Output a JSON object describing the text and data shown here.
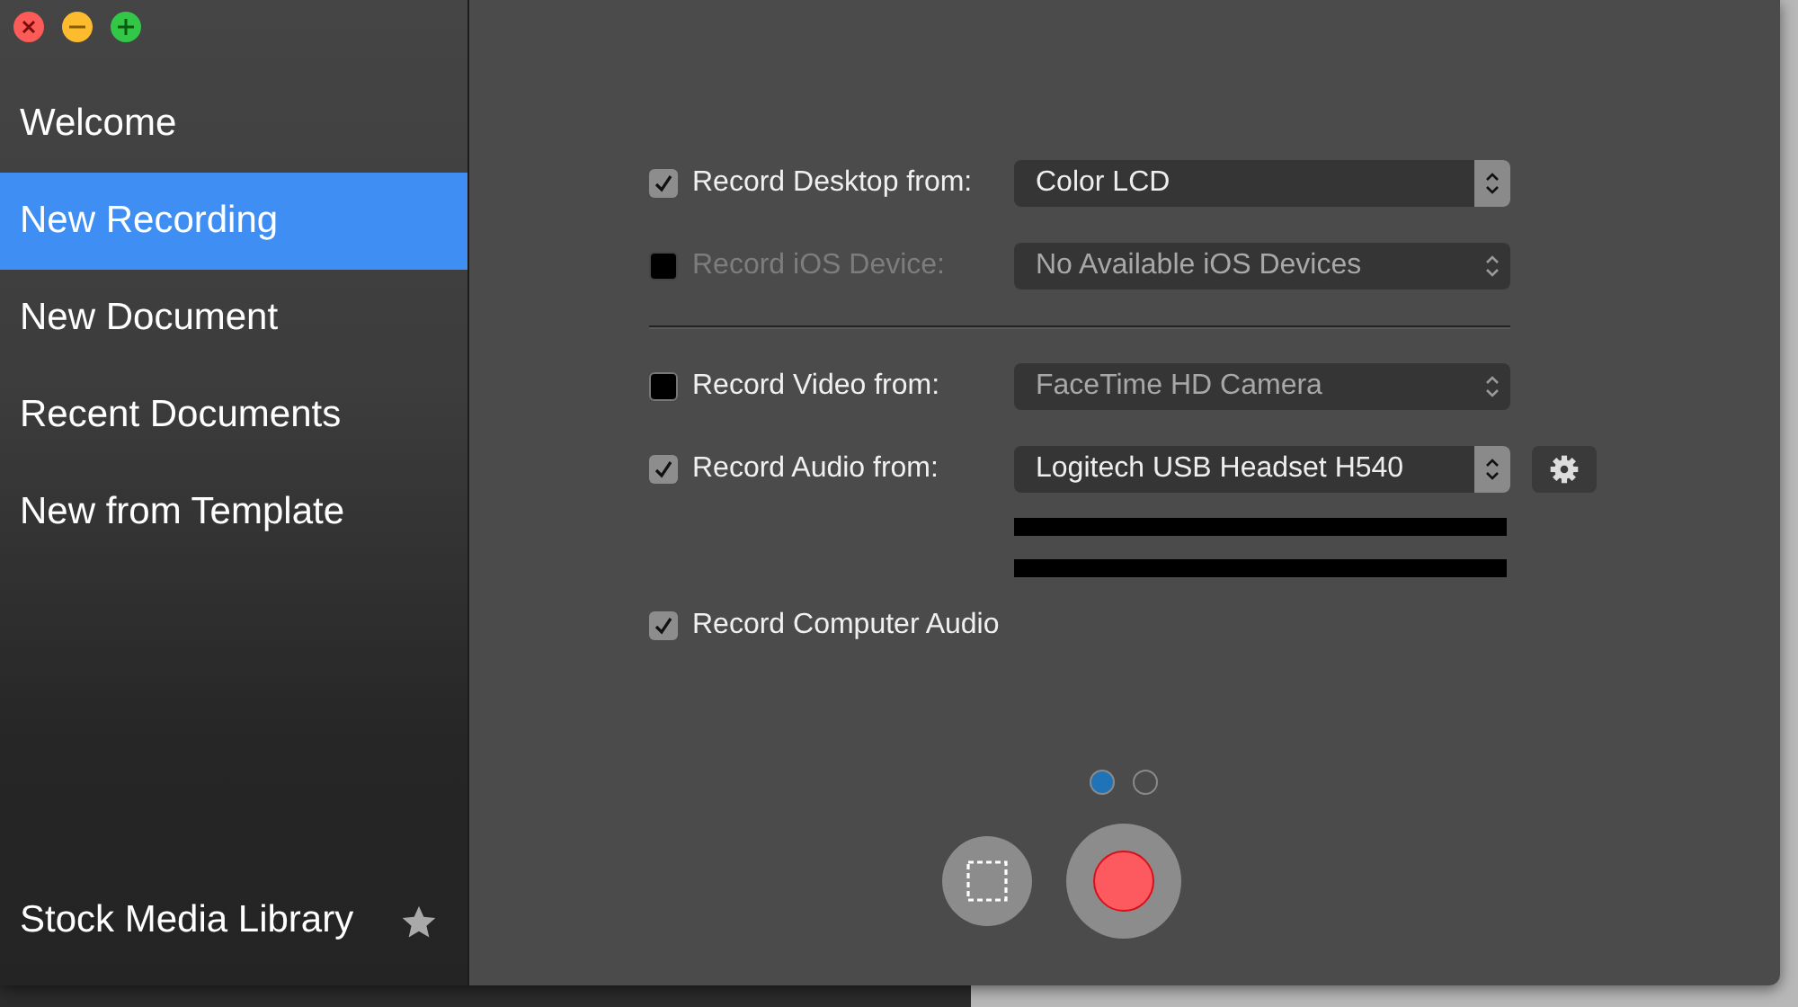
{
  "sidebar": {
    "items": [
      {
        "label": "Welcome",
        "selected": false
      },
      {
        "label": "New Recording",
        "selected": true
      },
      {
        "label": "New Document",
        "selected": false
      },
      {
        "label": "Recent Documents",
        "selected": false
      },
      {
        "label": "New from Template",
        "selected": false
      }
    ],
    "footer": {
      "label": "Stock Media Library"
    }
  },
  "options": [
    {
      "kind": "source",
      "label": "Record Desktop from:",
      "checked": true,
      "disabled": false,
      "value": "Color LCD",
      "has_settings": false
    },
    {
      "kind": "source",
      "label": "Record iOS Device:",
      "checked": false,
      "disabled": true,
      "value": "No Available iOS Devices",
      "has_settings": false
    },
    {
      "kind": "divider"
    },
    {
      "kind": "source",
      "label": "Record Video from:",
      "checked": false,
      "disabled": false,
      "value": "FaceTime HD Camera",
      "has_settings": false
    },
    {
      "kind": "source",
      "label": "Record Audio from:",
      "checked": true,
      "disabled": false,
      "value": "Logitech USB Headset H540",
      "has_settings": true
    },
    {
      "kind": "meters"
    },
    {
      "kind": "check",
      "label": "Record Computer Audio",
      "checked": true,
      "disabled": false
    }
  ],
  "pages": [
    {
      "selected": true
    },
    {
      "selected": false
    }
  ]
}
